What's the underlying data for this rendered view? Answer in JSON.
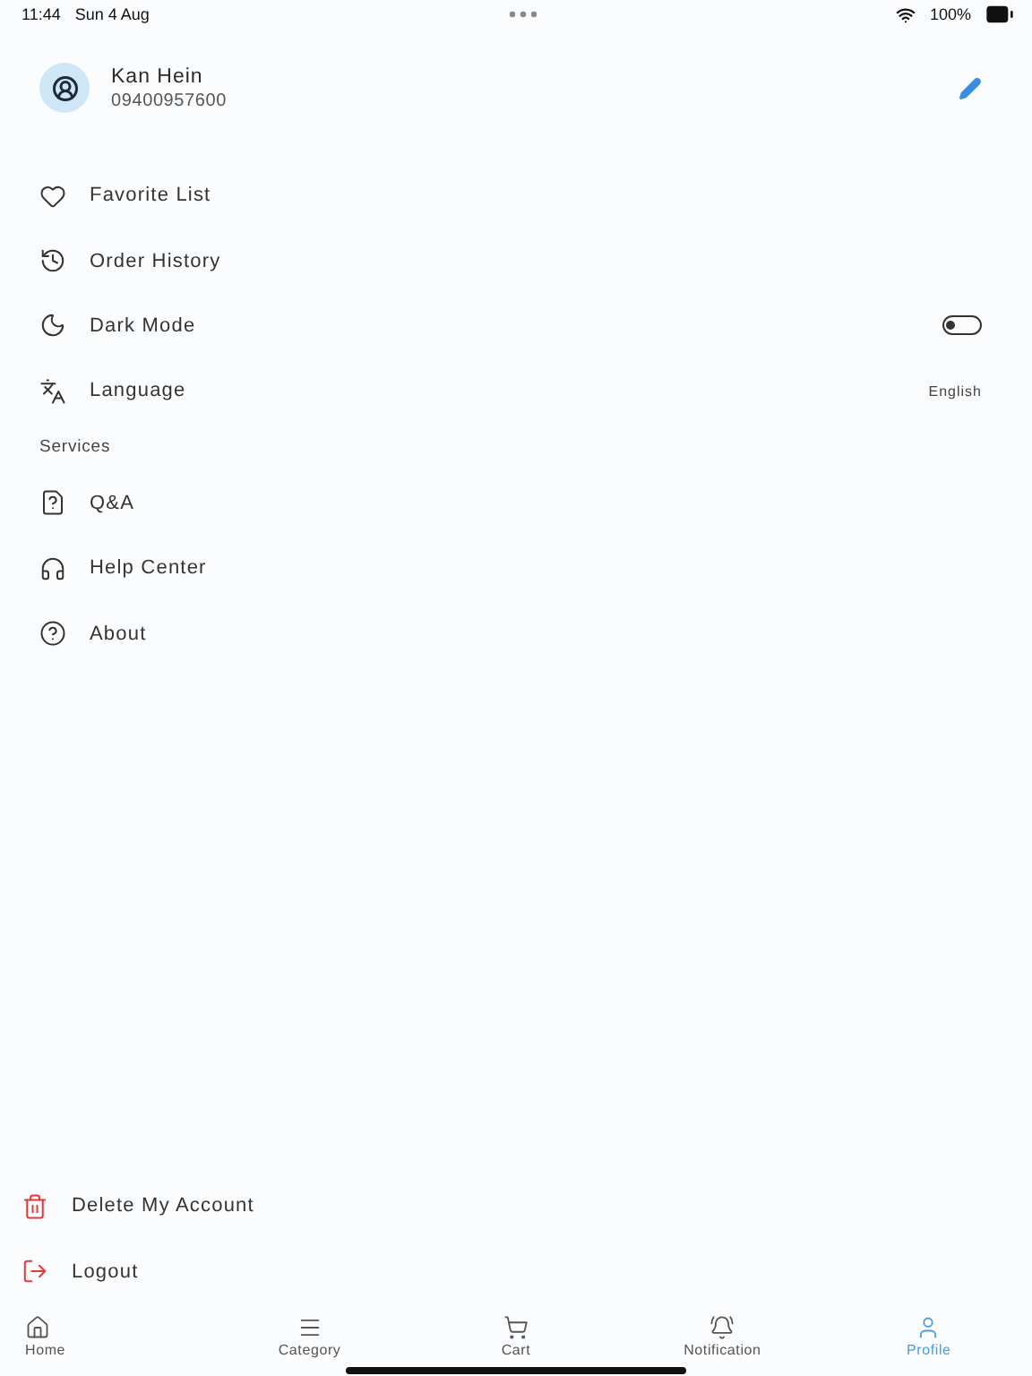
{
  "status_bar": {
    "time": "11:44",
    "date": "Sun 4 Aug",
    "battery": "100%"
  },
  "profile": {
    "name": "Kan Hein",
    "phone": "09400957600"
  },
  "menu": [
    {
      "kind": "link",
      "label": "Favorite List"
    },
    {
      "kind": "link",
      "label": "Order History"
    },
    {
      "kind": "toggle",
      "label": "Dark Mode",
      "on": false
    },
    {
      "kind": "value",
      "label": "Language",
      "value": "English"
    }
  ],
  "services": {
    "title": "Services",
    "items": [
      {
        "label": "Q&A"
      },
      {
        "label": "Help Center"
      },
      {
        "label": "About"
      }
    ]
  },
  "account_actions": [
    {
      "label": "Delete My Account"
    },
    {
      "label": "Logout"
    }
  ],
  "bottom_nav": [
    {
      "label": "Home",
      "selected": false
    },
    {
      "label": "Category",
      "selected": false
    },
    {
      "label": "Cart",
      "selected": false
    },
    {
      "label": "Notification",
      "selected": false
    },
    {
      "label": "Profile",
      "selected": true
    }
  ]
}
